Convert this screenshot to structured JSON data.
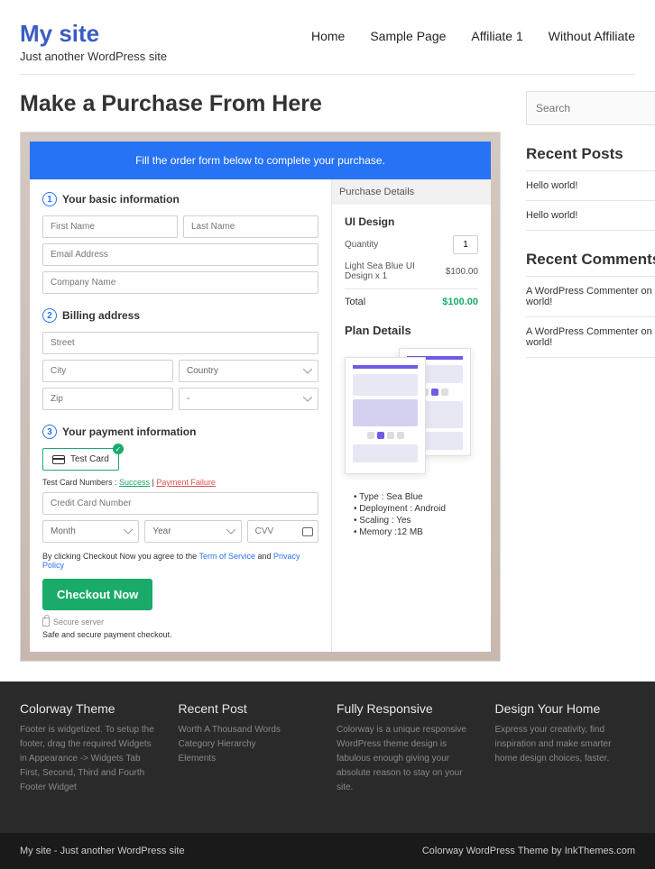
{
  "header": {
    "site_title": "My site",
    "tagline": "Just another WordPress site",
    "nav": [
      "Home",
      "Sample Page",
      "Affiliate 1",
      "Without Affiliate"
    ]
  },
  "page_title": "Make a Purchase From Here",
  "banner": "Fill the order form below to complete your purchase.",
  "steps": {
    "s1": "Your basic information",
    "s2": "Billing address",
    "s3": "Your payment information"
  },
  "placeholders": {
    "first_name": "First Name",
    "last_name": "Last Name",
    "email": "Email Address",
    "company": "Company Name",
    "street": "Street",
    "city": "City",
    "country": "Country",
    "zip": "Zip",
    "dash": "-",
    "cc": "Credit Card Number",
    "month": "Month",
    "year": "Year",
    "cvv": "CVV"
  },
  "test_card": "Test  Card",
  "hint_label": "Test Card Numbers : ",
  "hint_success": "Success",
  "hint_sep": " | ",
  "hint_failure": "Payment Failure",
  "terms_prefix": "By clicking Checkout Now you agree to the ",
  "terms_tos": "Term of Service",
  "terms_and": " and ",
  "terms_pp": "Privacy Policy",
  "checkout": "Checkout Now",
  "secure": "Secure server",
  "safe": "Safe and secure payment checkout.",
  "pd": {
    "header": "Purchase Details",
    "title": "UI Design",
    "qty_label": "Quantity",
    "qty": "1",
    "item": "Light Sea Blue UI Design x 1",
    "item_price": "$100.00",
    "total_label": "Total",
    "total": "$100.00"
  },
  "plan": {
    "title": "Plan Details",
    "items": [
      "Type : Sea Blue",
      "Deployment : Android",
      "Scaling : Yes",
      "Memory :12 MB"
    ]
  },
  "sidebar": {
    "search_placeholder": "Search",
    "recent_posts_title": "Recent Posts",
    "recent_posts": [
      "Hello world!",
      "Hello world!"
    ],
    "recent_comments_title": "Recent Comments",
    "recent_comments": [
      "A WordPress Commenter on Hello world!",
      "A WordPress Commenter on Hello world!"
    ]
  },
  "footer": {
    "cols": [
      {
        "title": "Colorway Theme",
        "body": "Footer is widgetized. To setup the footer, drag the required Widgets in Appearance -> Widgets Tab First, Second, Third and Fourth Footer Widget"
      },
      {
        "title": "Recent Post",
        "body": "Worth A Thousand Words\nCategory Hierarchy\nElements"
      },
      {
        "title": "Fully Responsive",
        "body": "Colorway is a unique responsive WordPress theme design is fabulous enough giving your absolute reason to stay on your site."
      },
      {
        "title": "Design Your Home",
        "body": "Express your creativity, find inspiration and make smarter home design choices, faster."
      }
    ],
    "bar_left": "My site - Just another WordPress site",
    "bar_right": "Colorway WordPress Theme by InkThemes.com"
  }
}
